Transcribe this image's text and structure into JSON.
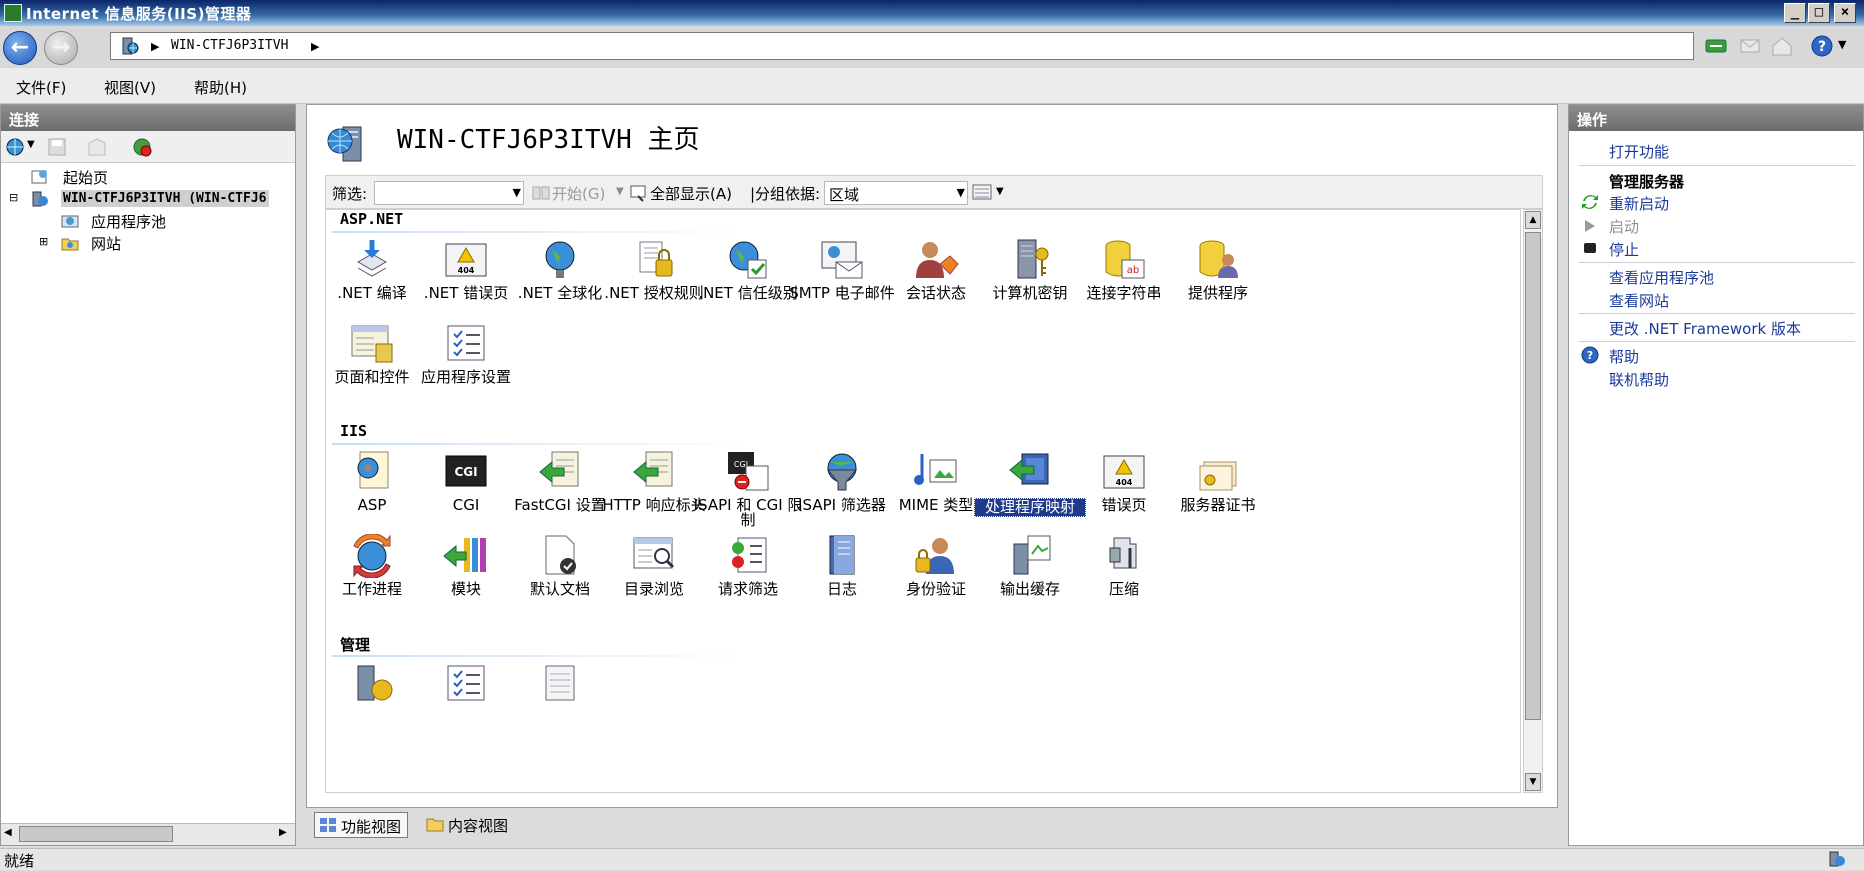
{
  "window": {
    "title": "Internet 信息服务(IIS)管理器"
  },
  "address": {
    "path": "WIN-CTFJ6P3ITVH"
  },
  "menu": {
    "file": "文件(F)",
    "view": "视图(V)",
    "help": "帮助(H)"
  },
  "left_panel": {
    "header": "连接",
    "tree": {
      "start_page": "起始页",
      "server": "WIN-CTFJ6P3ITVH (WIN-CTFJ6",
      "app_pools": "应用程序池",
      "sites": "网站"
    }
  },
  "center": {
    "title": "WIN-CTFJ6P3ITVH 主页",
    "filter": {
      "label": "筛选:",
      "start": "开始(G)",
      "show_all": "全部显示(A)",
      "group_by_label": "|分组依据:",
      "group_by_value": "区域"
    },
    "groups": {
      "aspnet": "ASP.NET",
      "iis": "IIS",
      "management": "管理"
    },
    "aspnet_features": [
      ".NET 编译",
      ".NET 错误页",
      ".NET 全球化",
      ".NET 授权规则",
      ".NET 信任级别",
      "SMTP 电子邮件",
      "会话状态",
      "计算机密钥",
      "连接字符串",
      "提供程序",
      "页面和控件",
      "应用程序设置"
    ],
    "iis_features": [
      "ASP",
      "CGI",
      "FastCGI 设置",
      "HTTP 响应标头",
      "ISAPI 和 CGI 限制",
      "ISAPI 筛选器",
      "MIME 类型",
      "处理程序映射",
      "错误页",
      "服务器证书",
      "工作进程",
      "模块",
      "默认文档",
      "目录浏览",
      "请求筛选",
      "日志",
      "身份验证",
      "输出缓存",
      "压缩"
    ],
    "view_tabs": {
      "features": "功能视图",
      "content": "内容视图"
    }
  },
  "right_panel": {
    "header": "操作",
    "open_feature": "打开功能",
    "manage_server": "管理服务器",
    "restart": "重新启动",
    "start": "启动",
    "stop": "停止",
    "view_app_pools": "查看应用程序池",
    "view_sites": "查看网站",
    "change_framework": "更改 .NET Framework 版本",
    "help": "帮助",
    "online_help": "联机帮助"
  },
  "status": {
    "text": "就绪"
  },
  "colors": {
    "selection": "#1f3a8c",
    "link": "#1a3a9a",
    "panel_header": "#7a7a7a"
  }
}
